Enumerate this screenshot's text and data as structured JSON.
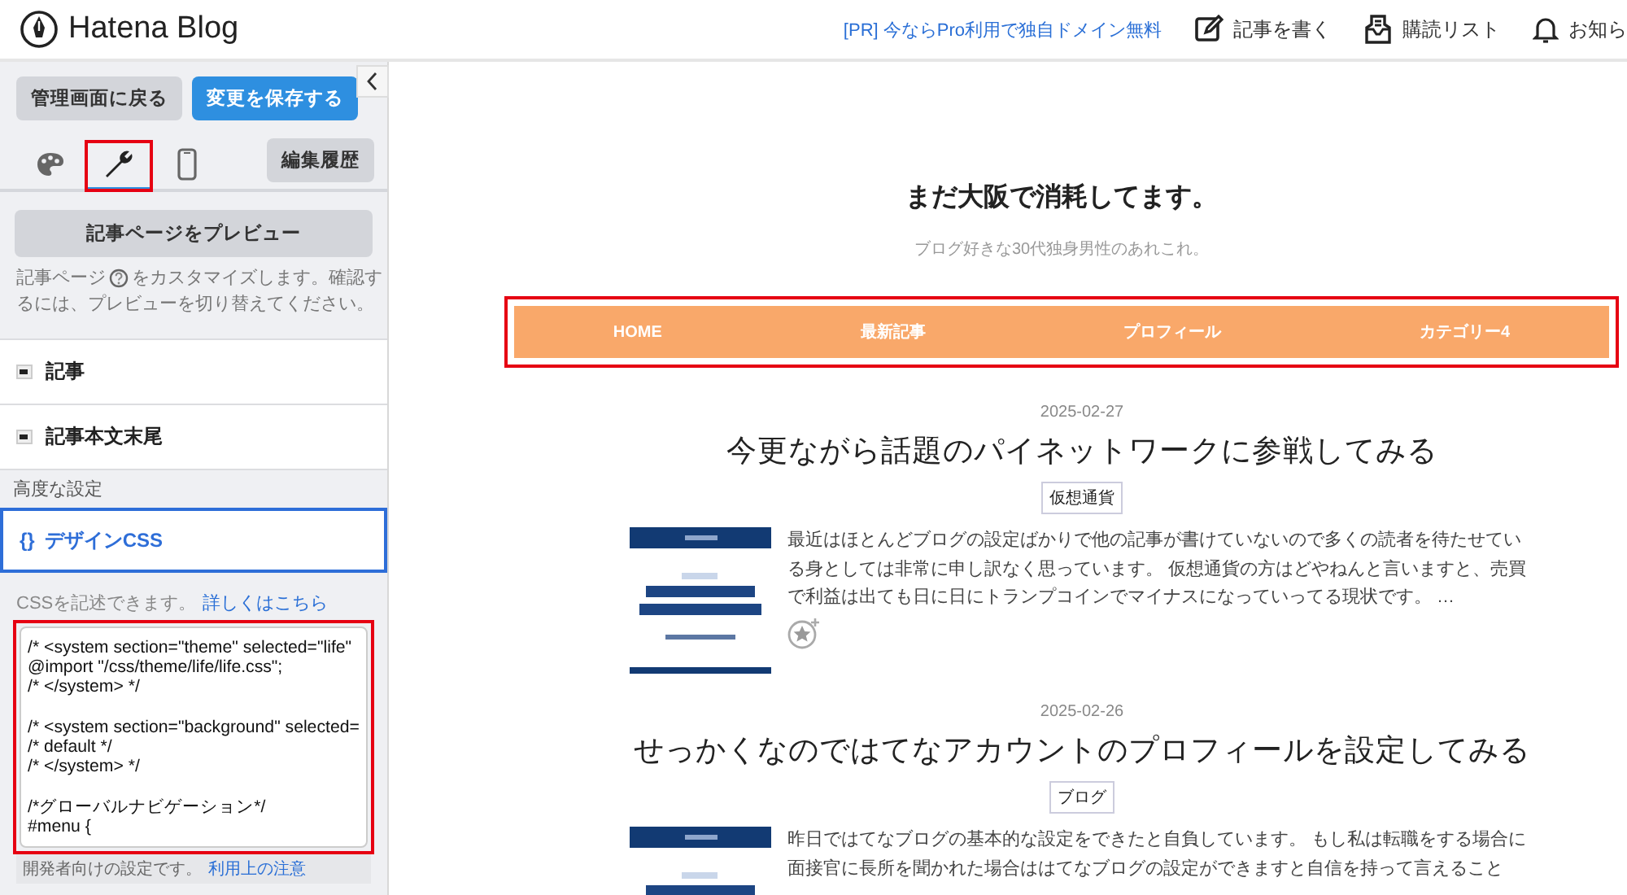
{
  "header": {
    "logo_text": "Hatena Blog",
    "pr_link": "[PR] 今ならPro利用で独自ドメイン無料",
    "actions": [
      {
        "kind": "write",
        "label": "記事を書く"
      },
      {
        "kind": "subscriptions",
        "label": "購読リスト"
      },
      {
        "kind": "notifications",
        "label": "お知ら"
      }
    ]
  },
  "sidebar": {
    "back_button": "管理画面に戻る",
    "save_button": "変更を保存する",
    "tabs": [
      {
        "kind": "palette",
        "selected": false,
        "highlighted": false
      },
      {
        "kind": "wrench",
        "selected": true,
        "highlighted": true
      },
      {
        "kind": "phone",
        "selected": false,
        "highlighted": false
      }
    ],
    "history_button": "編集履歴",
    "preview_button": "記事ページをプレビュー",
    "description_lines": [
      "記事ページ",
      "をカスタマイズします。確認す",
      "るには、プレビューを切り替えてください。"
    ],
    "sections": [
      {
        "label": "記事"
      },
      {
        "label": "記事本文末尾"
      }
    ],
    "advanced_heading": "高度な設定",
    "css_section": {
      "icon_text": "{}",
      "label": "デザインCSS",
      "selected": true
    },
    "css_note": "CSSを記述できます。",
    "css_link": "詳しくはこちら",
    "css_editor": {
      "highlighted": true,
      "blocks": [
        [
          "/* <system section=\"theme\" selected=\"life\"",
          "@import \"/css/theme/life/life.css\";",
          "/* </system> */"
        ],
        [
          "/* <system section=\"background\" selected=",
          "/* default */",
          "/* </system> */"
        ],
        [
          "/*グローバルナビゲーション*/",
          "#menu {"
        ]
      ]
    },
    "dev_note": "開発者向けの設定です。",
    "dev_link": "利用上の注意"
  },
  "blog": {
    "title": "まだ大阪で消耗してます。",
    "description": "ブログ好きな30代独身男性のあれこれ。",
    "nav": {
      "highlighted": true,
      "items": [
        "HOME",
        "最新記事",
        "プロフィール",
        "カテゴリー4"
      ]
    },
    "posts": [
      {
        "date": "2025-02-27",
        "title": "今更ながら話題のパイネットワークに参戦してみる",
        "category": "仮想通貨",
        "excerpt": "最近はほとんどブログの設定ばかりで他の記事が書けていないので多くの読者を待たせている身としては非常に申し訳なく思っています。 仮想通貨の方はどやねんと言いますと、売買で利益は出ても日に日にトランプコインでマイナスになっていってる現状です。 …",
        "star_button": true
      },
      {
        "date": "2025-02-26",
        "title": "せっかくなのではてなアカウントのプロフィールを設定してみる",
        "category": "ブログ",
        "excerpt": "昨日ではてなブログの基本的な設定をできたと自負しています。 もし私は転職をする場合に面接官に長所を聞かれた場合ははてなブログの設定ができますと自信を持って言えること",
        "star_button": false
      }
    ]
  }
}
